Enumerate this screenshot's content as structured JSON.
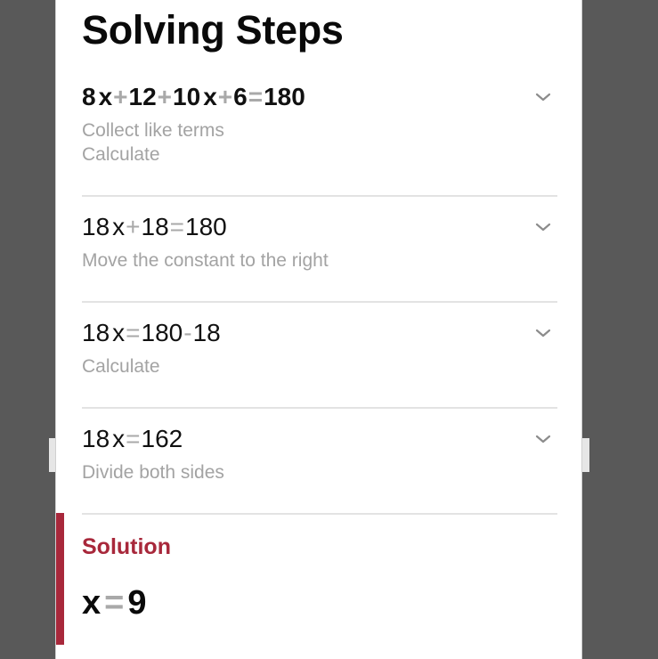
{
  "title": "Solving Steps",
  "steps": [
    {
      "equation_parts": [
        {
          "t": "8",
          "k": "num"
        },
        {
          "t": "x",
          "k": "var"
        },
        {
          "t": "+",
          "k": "op"
        },
        {
          "t": "12",
          "k": "num"
        },
        {
          "t": "+",
          "k": "op"
        },
        {
          "t": "10",
          "k": "num"
        },
        {
          "t": "x",
          "k": "var"
        },
        {
          "t": "+",
          "k": "op"
        },
        {
          "t": "6",
          "k": "num"
        },
        {
          "t": "=",
          "k": "op"
        },
        {
          "t": "180",
          "k": "num"
        }
      ],
      "equation_text": "8x + 12 + 10x + 6 = 180",
      "bold": true,
      "descriptions": [
        "Collect like terms",
        "Calculate"
      ],
      "icon": "chevron-down-icon"
    },
    {
      "equation_parts": [
        {
          "t": "18",
          "k": "num"
        },
        {
          "t": "x",
          "k": "var"
        },
        {
          "t": "+",
          "k": "op"
        },
        {
          "t": "18",
          "k": "num"
        },
        {
          "t": "=",
          "k": "op"
        },
        {
          "t": "180",
          "k": "num"
        }
      ],
      "equation_text": "18x + 18 = 180",
      "bold": false,
      "descriptions": [
        "Move the constant to the right"
      ],
      "icon": "chevron-down-icon"
    },
    {
      "equation_parts": [
        {
          "t": "18",
          "k": "num"
        },
        {
          "t": "x",
          "k": "var"
        },
        {
          "t": "=",
          "k": "op"
        },
        {
          "t": "180",
          "k": "num"
        },
        {
          "t": "-",
          "k": "op"
        },
        {
          "t": "18",
          "k": "num"
        }
      ],
      "equation_text": "18x = 180 - 18",
      "bold": false,
      "descriptions": [
        "Calculate"
      ],
      "icon": "chevron-down-icon"
    },
    {
      "equation_parts": [
        {
          "t": "18",
          "k": "num"
        },
        {
          "t": "x",
          "k": "var"
        },
        {
          "t": "=",
          "k": "op"
        },
        {
          "t": "162",
          "k": "num"
        }
      ],
      "equation_text": "18x = 162",
      "bold": false,
      "descriptions": [
        "Divide both sides"
      ],
      "icon": "chevron-down-icon"
    }
  ],
  "solution": {
    "label": "Solution",
    "lhs": "x",
    "op": "=",
    "rhs": "9"
  },
  "colors": {
    "accent": "#a8283b",
    "operator": "#a9a9a9",
    "description": "#a3a3a3",
    "background_outside": "#595959"
  }
}
